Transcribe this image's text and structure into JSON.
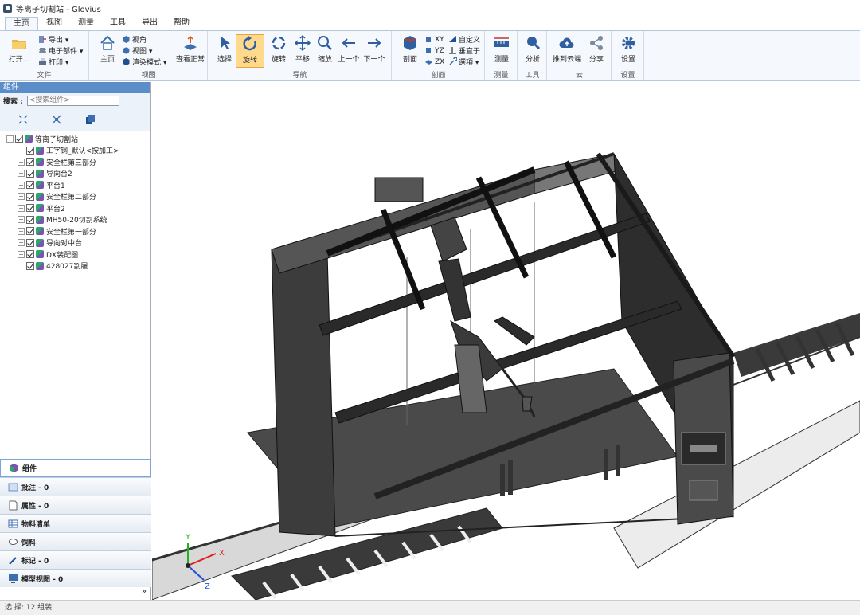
{
  "window": {
    "title": "等离子切割站 - Glovius"
  },
  "menu": [
    "主页",
    "视图",
    "测量",
    "工具",
    "导出",
    "帮助"
  ],
  "ribbon": {
    "file": {
      "label": "文件",
      "open": "打开...",
      "export": "导出 ▾",
      "ecad": "电子部件 ▾",
      "print": "打印 ▾"
    },
    "view": {
      "label": "视图",
      "home": "主页",
      "view_angle": "视角",
      "views": "视图 ▾",
      "render": "渲染模式 ▾",
      "normal": "查看正常"
    },
    "nav": {
      "label": "导航",
      "select": "选择",
      "rotate_sel": "旋转",
      "rotate": "旋转",
      "pan": "平移",
      "zoom": "缩放",
      "prev": "上一个",
      "next": "下一个"
    },
    "section": {
      "label": "剖面",
      "cut": "剖面",
      "xy": "XY",
      "yz": "YZ",
      "zx": "ZX",
      "custom": "自定义",
      "perp": "垂直于",
      "options": "選項 ▾"
    },
    "measure": {
      "label": "测量",
      "btn": "测量"
    },
    "tools": {
      "label": "工具",
      "btn": "分析"
    },
    "cloud": {
      "label": "云",
      "push": "推到云端",
      "share": "分享"
    },
    "settings": {
      "label": "设置",
      "btn": "设置"
    }
  },
  "panel": {
    "title": "组件",
    "search_label": "搜索 :",
    "search_placeholder": "<搜索组件>"
  },
  "tree": [
    {
      "label": "等离子切割站",
      "level": 0,
      "exp": "⊟"
    },
    {
      "label": "工字钢_默认<按加工>",
      "level": 1,
      "exp": ""
    },
    {
      "label": "安全栏第三部分",
      "level": 1,
      "exp": "⊞"
    },
    {
      "label": "导向台2",
      "level": 1,
      "exp": "⊞"
    },
    {
      "label": "平台1",
      "level": 1,
      "exp": "⊞"
    },
    {
      "label": "安全栏第二部分",
      "level": 1,
      "exp": "⊞"
    },
    {
      "label": "平台2",
      "level": 1,
      "exp": "⊞"
    },
    {
      "label": "MH50-20切割系统",
      "level": 1,
      "exp": "⊞"
    },
    {
      "label": "安全栏第一部分",
      "level": 1,
      "exp": "⊞"
    },
    {
      "label": "导向对中台",
      "level": 1,
      "exp": "⊞"
    },
    {
      "label": "DX装配图",
      "level": 1,
      "exp": "⊞"
    },
    {
      "label": "428027割履",
      "level": 1,
      "exp": ""
    }
  ],
  "tabs": [
    {
      "label": "组件",
      "icon": "components-icon"
    },
    {
      "label": "批注 - 0",
      "icon": "annotation-icon"
    },
    {
      "label": "属性 - 0",
      "icon": "properties-icon"
    },
    {
      "label": "物料清单",
      "icon": "bom-icon"
    },
    {
      "label": "饲料",
      "icon": "feedback-icon"
    },
    {
      "label": "标记 - 0",
      "icon": "markup-icon"
    },
    {
      "label": "模型视图 - 0",
      "icon": "model-view-icon"
    }
  ],
  "collapse": "»",
  "axes": {
    "x": "X",
    "y": "Y",
    "z": "Z"
  },
  "status": "选 择: 12 组装",
  "colors": {
    "accent": "#5b8ec9",
    "ribbon_bg": "#f5f8fc",
    "selected": "#ffd98c"
  }
}
